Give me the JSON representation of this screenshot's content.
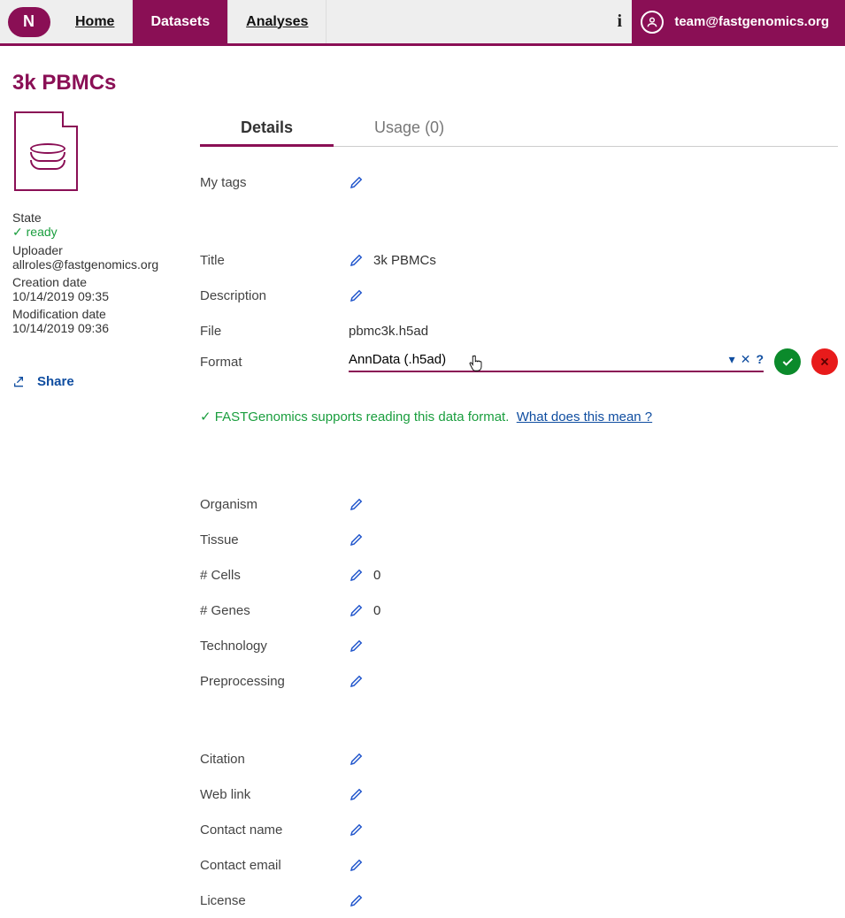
{
  "topbar": {
    "nav": [
      "Home",
      "Datasets",
      "Analyses"
    ],
    "active_nav_index": 1,
    "user_email": "team@fastgenomics.org"
  },
  "page_title": "3k PBMCs",
  "sidebar": {
    "state_label": "State",
    "state_value": "✓ ready",
    "uploader_label": "Uploader",
    "uploader_value": "allroles@fastgenomics.org",
    "creation_label": "Creation date",
    "creation_value": "10/14/2019 09:35",
    "modification_label": "Modification date",
    "modification_value": "10/14/2019 09:36",
    "share_label": "Share"
  },
  "tabs": {
    "details": "Details",
    "usage": "Usage (0)",
    "active": "details"
  },
  "fields": {
    "my_tags_label": "My tags",
    "title_label": "Title",
    "title_value": "3k PBMCs",
    "description_label": "Description",
    "file_label": "File",
    "file_value": "pbmc3k.h5ad",
    "format_label": "Format",
    "format_value": "AnnData (.h5ad)",
    "support_prefix": "✓ FASTGenomics supports reading this data format.",
    "support_link": "What does this mean ?",
    "organism_label": "Organism",
    "tissue_label": "Tissue",
    "cells_label": "# Cells",
    "cells_value": "0",
    "genes_label": "# Genes",
    "genes_value": "0",
    "technology_label": "Technology",
    "preprocessing_label": "Preprocessing",
    "citation_label": "Citation",
    "weblink_label": "Web link",
    "contactname_label": "Contact name",
    "contactemail_label": "Contact email",
    "license_label": "License"
  }
}
